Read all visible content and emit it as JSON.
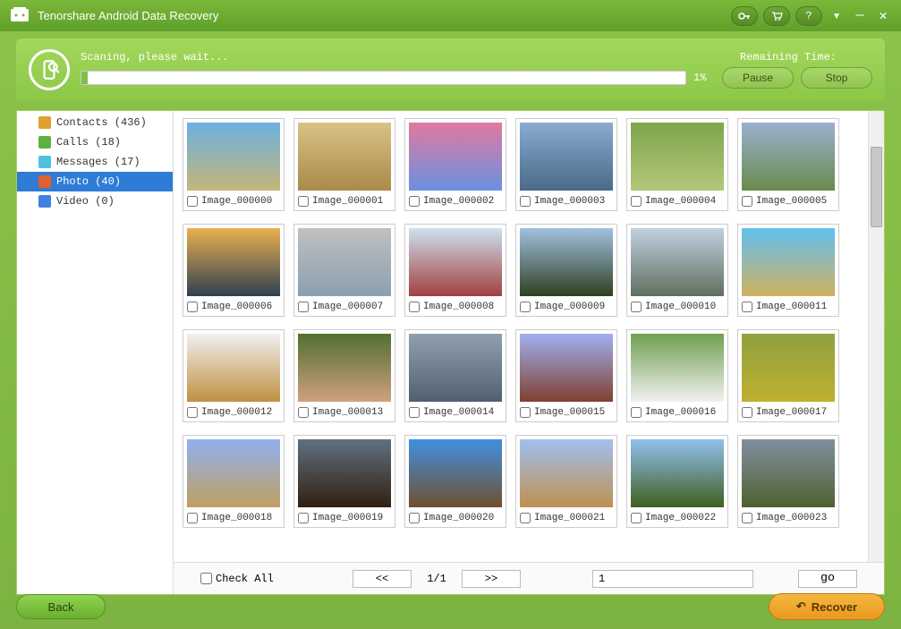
{
  "titlebar": {
    "app_title": "Tenorshare Android Data Recovery"
  },
  "scan": {
    "status_label": "Scaning, please wait...",
    "remaining_label": "Remaining Time:",
    "percent": "1%",
    "pause_label": "Pause",
    "stop_label": "Stop"
  },
  "sidebar": {
    "items": [
      {
        "label": "Contacts (436)",
        "icon_color": "#e0a030"
      },
      {
        "label": "Calls (18)",
        "icon_color": "#60b040"
      },
      {
        "label": "Messages (17)",
        "icon_color": "#50c0e0"
      },
      {
        "label": "Photo (40)",
        "icon_color": "#e06030",
        "selected": true
      },
      {
        "label": "Video (0)",
        "icon_color": "#4080e0"
      }
    ]
  },
  "thumbs": [
    "Image_000000",
    "Image_000001",
    "Image_000002",
    "Image_000003",
    "Image_000004",
    "Image_000005",
    "Image_000006",
    "Image_000007",
    "Image_000008",
    "Image_000009",
    "Image_000010",
    "Image_000011",
    "Image_000012",
    "Image_000013",
    "Image_000014",
    "Image_000015",
    "Image_000016",
    "Image_000017",
    "Image_000018",
    "Image_000019",
    "Image_000020",
    "Image_000021",
    "Image_000022",
    "Image_000023"
  ],
  "pager": {
    "check_all_label": "Check All",
    "prev_label": "<<",
    "page_display": "1/1",
    "next_label": ">>",
    "page_input_value": "1",
    "go_label": "go"
  },
  "bottom": {
    "back_label": "Back",
    "recover_label": "Recover"
  }
}
